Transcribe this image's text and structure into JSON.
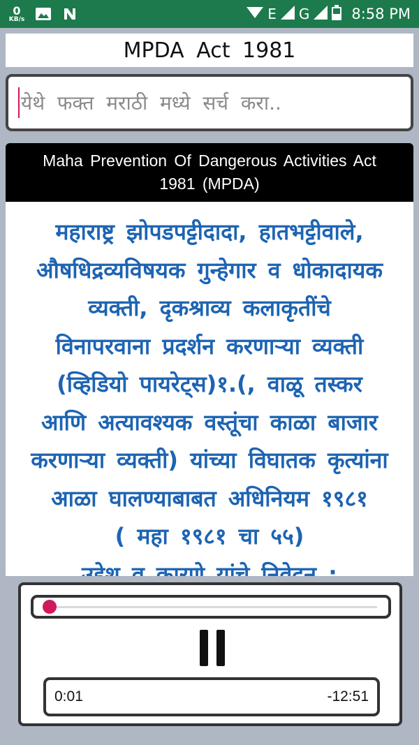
{
  "status_bar": {
    "speed_value": "0",
    "speed_unit": "KB/s",
    "network_labels": [
      "E",
      "G"
    ],
    "time": "8:58 PM",
    "icons": [
      "gallery-icon",
      "n-notification-icon",
      "wifi-icon",
      "signal-icon",
      "battery-icon"
    ]
  },
  "header": {
    "title": "MPDA  Act  1981"
  },
  "search": {
    "placeholder": "येथे  फक्त  मराठी  मध्ये  सर्च  करा.."
  },
  "card": {
    "title": "Maha Prevention Of Dangerous Activities Act 1981 (MPDA)",
    "body_lines": [
      "महाराष्ट्र झोपडपट्टीदादा, हातभट्टीवाले,",
      "औषधिद्रव्यविषयक गुन्हेगार व धोकादायक",
      "व्यक्ती,  दृकश्राव्य कलाकृतींचे",
      "विनापरवाना प्रदर्शन करणाऱ्या व्यक्ती",
      "(व्हिडियो पायरेट्स)१.(, वाळू तस्कर",
      "आणि अत्यावश्यक वस्तूंचा काळा बाजार",
      "करणाऱ्या व्यक्ती) यांच्या विघातक कृत्यांना",
      "आळा घालण्याबाबत अधिनियम १९८१",
      "( महा १९८१ चा ५५)"
    ],
    "heading": "उद्देश व कारणे यांचे निवेदन :"
  },
  "player": {
    "elapsed": "0:01",
    "remaining": "-12:51",
    "progress": 0.0013,
    "accent": "#d0195d"
  },
  "colors": {
    "status_bar": "#1c7a4c",
    "background": "#aeb7c3",
    "marathi_text": "#1d64b3"
  }
}
